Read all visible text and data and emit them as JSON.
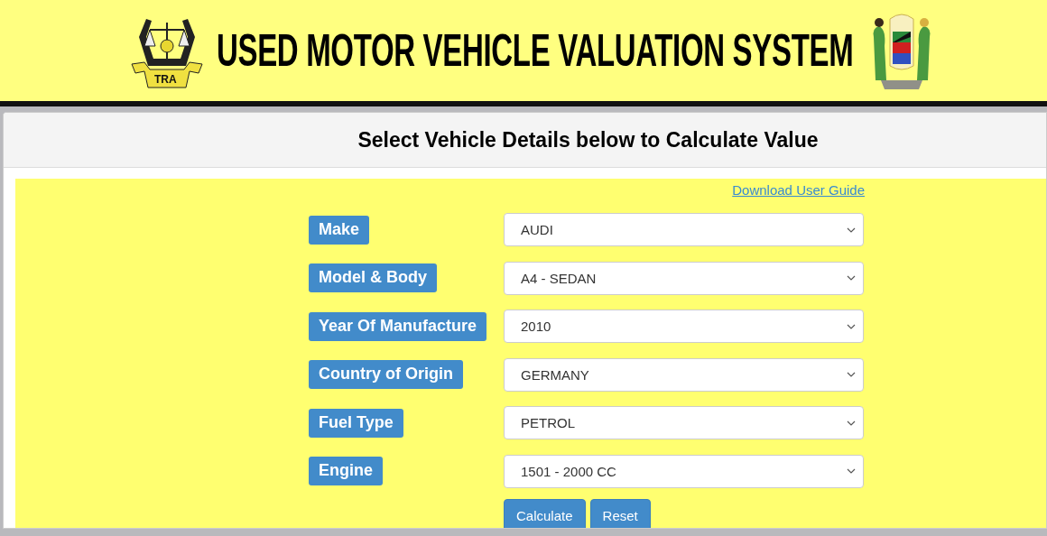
{
  "header": {
    "title": "USED MOTOR VEHICLE VALUATION SYSTEM",
    "logo_text": "TRA"
  },
  "panel": {
    "heading": "Select Vehicle Details below to Calculate Value"
  },
  "guide_link": "Download User Guide",
  "fields": [
    {
      "label": "Make",
      "value": "AUDI"
    },
    {
      "label": "Model & Body",
      "value": "A4 - SEDAN"
    },
    {
      "label": "Year Of Manufacture",
      "value": "2010"
    },
    {
      "label": "Country of Origin",
      "value": "GERMANY"
    },
    {
      "label": "Fuel Type",
      "value": "PETROL"
    },
    {
      "label": "Engine",
      "value": "1501 - 2000 CC"
    }
  ],
  "buttons": [
    "Calculate",
    "Reset"
  ]
}
